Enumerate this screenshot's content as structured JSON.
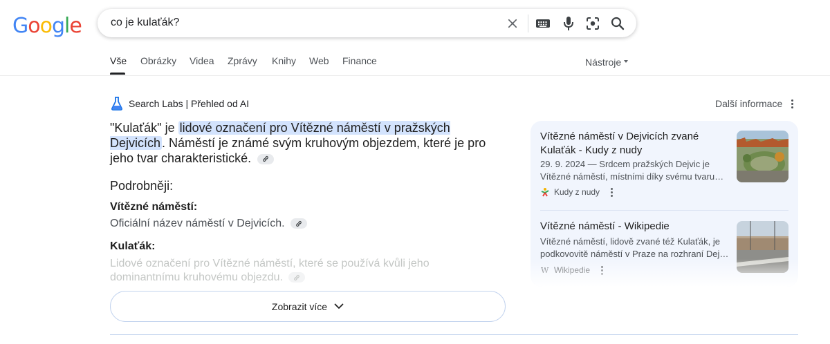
{
  "logo": {
    "letters": [
      "G",
      "o",
      "o",
      "g",
      "l",
      "e"
    ],
    "colors": [
      "#4285F4",
      "#EA4335",
      "#FBBC05",
      "#4285F4",
      "#34A853",
      "#EA4335"
    ]
  },
  "search": {
    "query": "co je kulaťák?",
    "icons": [
      "close-icon",
      "keyboard-icon",
      "microphone-icon",
      "lens-icon",
      "search-icon"
    ]
  },
  "tabs": [
    "Vše",
    "Obrázky",
    "Videa",
    "Zprávy",
    "Knihy",
    "Web",
    "Finance"
  ],
  "tools_label": "Nástroje",
  "ai": {
    "label": "Search Labs | Přehled od AI",
    "more_info": "Další informace",
    "answer_before": "\"Kulaťák\" je ",
    "answer_highlight": "lidové označení pro Vítězné náměstí v pražských Dejvicích",
    "answer_after": ". Náměstí je známé svým kruhovým objezdem, které je pro jeho tvar charakteristické.",
    "details_heading": "Podrobněji:",
    "items": [
      {
        "term": "Vítězné náměstí:",
        "desc": "Oficiální název náměstí v Dejvicích."
      },
      {
        "term": "Kulaťák:",
        "desc": "Lidové označení pro Vítězné náměstí, které se používá kvůli jeho dominantnímu kruhovému objezdu."
      }
    ],
    "show_more": "Zobrazit více"
  },
  "sources": [
    {
      "title": "Vítězné náměstí v Dejvicích zvané Kulaťák - Kudy z nudy",
      "snippet": "29. 9. 2024 — Srdcem pražských Dejvic je Vítězné náměstí, místními díky svému tvaru…",
      "site": "Kudy z nudy"
    },
    {
      "title": "Vítězné náměstí - Wikipedie",
      "snippet": "Vítězné náměstí, lidově zvané též Kulaťák, je podkovovitě náměstí v Praze na rozhraní Dej…",
      "site": "Wikipedie"
    }
  ]
}
